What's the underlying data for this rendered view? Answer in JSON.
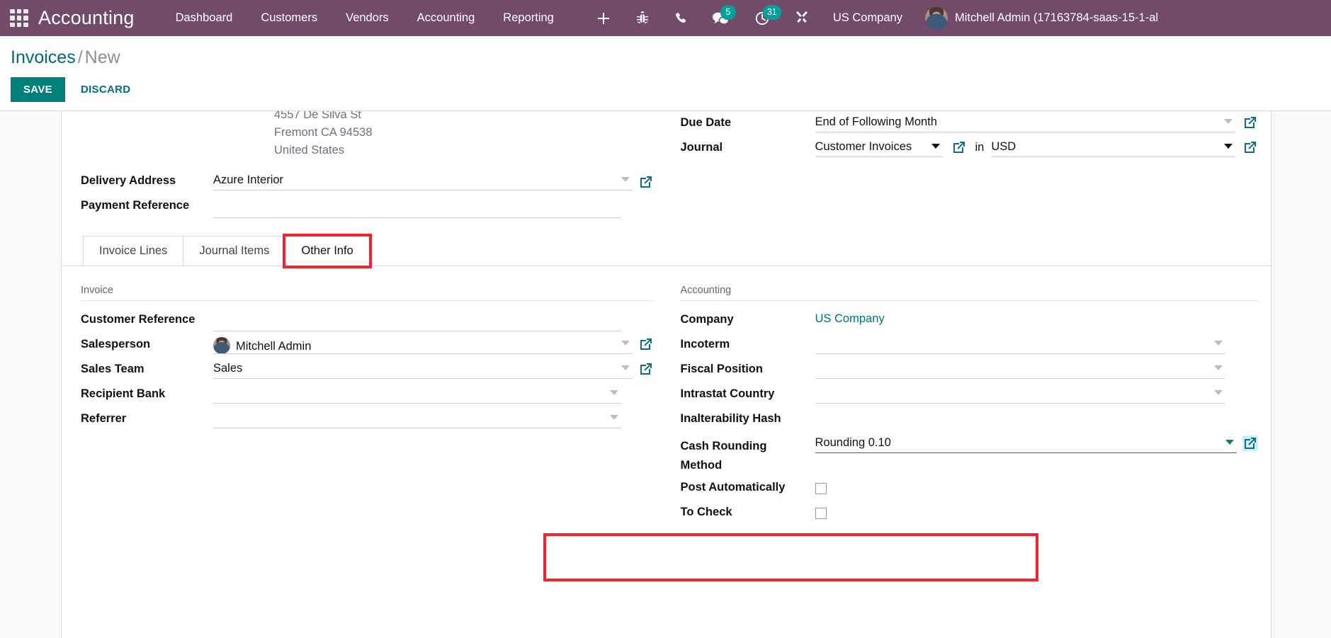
{
  "navbar": {
    "apps_icon": "apps-grid-icon",
    "brand": "Accounting",
    "menu": [
      {
        "label": "Dashboard"
      },
      {
        "label": "Customers"
      },
      {
        "label": "Vendors"
      },
      {
        "label": "Accounting"
      },
      {
        "label": "Reporting"
      }
    ],
    "plus_icon": "plus-icon",
    "bug_icon": "bug-icon",
    "phone_icon": "phone-icon",
    "messages_icon": "chat-bubble-icon",
    "messages_count": "5",
    "activities_icon": "clock-icon",
    "activities_count": "31",
    "tools_icon": "tools-icon",
    "company": "US Company",
    "avatar_icon": "user-avatar",
    "user": "Mitchell Admin (17163784-saas-15-1-al"
  },
  "control_panel": {
    "breadcrumb_root": "Invoices",
    "breadcrumb_sep": "/",
    "breadcrumb_current": "New",
    "save_label": "SAVE",
    "discard_label": "DISCARD"
  },
  "header_form": {
    "address_lines": [
      "4557 De Silva St",
      "Fremont CA 94538",
      "United States"
    ],
    "delivery_address_label": "Delivery Address",
    "delivery_address_value": "Azure Interior",
    "payment_reference_label": "Payment Reference",
    "payment_reference_value": "",
    "due_date_label": "Due Date",
    "due_date_value": "End of Following Month",
    "journal_label": "Journal",
    "journal_value": "Customer Invoices",
    "in_label": "in",
    "currency_value": "USD"
  },
  "notebook": {
    "tabs": [
      {
        "label": "Invoice Lines",
        "active": false,
        "highlighted": false
      },
      {
        "label": "Journal Items",
        "active": false,
        "highlighted": false
      },
      {
        "label": "Other Info",
        "active": true,
        "highlighted": true
      }
    ]
  },
  "other_info": {
    "invoice_section_title": "Invoice",
    "accounting_section_title": "Accounting",
    "invoice_fields": {
      "customer_reference_label": "Customer Reference",
      "customer_reference_value": "",
      "salesperson_label": "Salesperson",
      "salesperson_value": "Mitchell Admin",
      "sales_team_label": "Sales Team",
      "sales_team_value": "Sales",
      "recipient_bank_label": "Recipient Bank",
      "recipient_bank_value": "",
      "referrer_label": "Referrer",
      "referrer_value": ""
    },
    "accounting_fields": {
      "company_label": "Company",
      "company_value": "US Company",
      "incoterm_label": "Incoterm",
      "incoterm_value": "",
      "fiscal_position_label": "Fiscal Position",
      "fiscal_position_value": "",
      "intrastat_country_label": "Intrastat Country",
      "intrastat_country_value": "",
      "inalterability_hash_label": "Inalterability Hash",
      "inalterability_hash_value": "",
      "cash_rounding_label_line1": "Cash Rounding",
      "cash_rounding_label_line2": "Method",
      "cash_rounding_value": "Rounding 0.10",
      "post_automatically_label": "Post Automatically",
      "to_check_label": "To Check"
    }
  },
  "colors": {
    "brand_purple": "#714B67",
    "teal": "#00807B",
    "badge_teal": "#00A09D",
    "highlight_red": "#F5222D",
    "link_blue": "#00707e"
  }
}
